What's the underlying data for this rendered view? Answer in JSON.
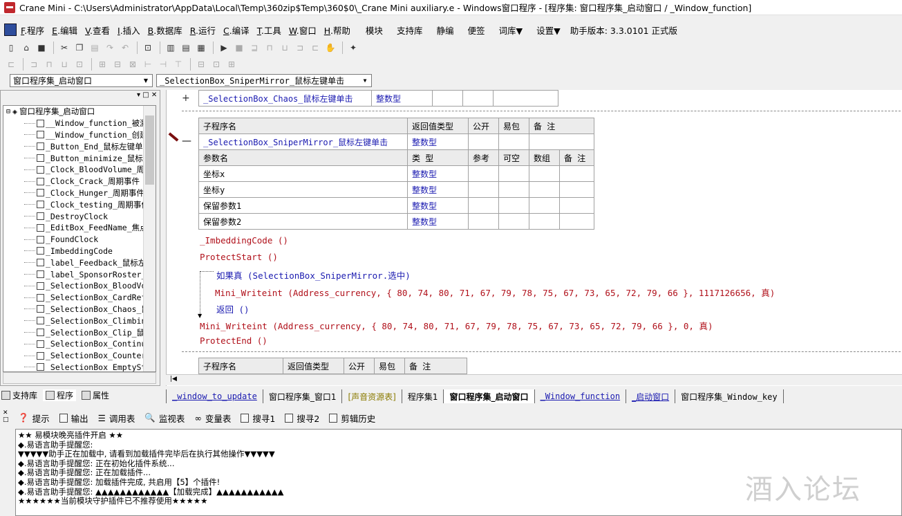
{
  "title": "Crane Mini - C:\\Users\\Administrator\\AppData\\Local\\Temp\\360zip$Temp\\360$0\\_Crane Mini auxiliary.e - Windows窗口程序 - [程序集: 窗口程序集_启动窗口 / _Window_function]",
  "menu": [
    {
      "key": "F",
      "label": ".程序"
    },
    {
      "key": "E",
      "label": ".编辑"
    },
    {
      "key": "V",
      "label": ".查看"
    },
    {
      "key": "I",
      "label": ".插入"
    },
    {
      "key": "B",
      "label": ".数据库"
    },
    {
      "key": "R",
      "label": ".运行"
    },
    {
      "key": "C",
      "label": ".编译"
    },
    {
      "key": "T",
      "label": ".工具"
    },
    {
      "key": "W",
      "label": ".窗口"
    },
    {
      "key": "H",
      "label": ".帮助"
    }
  ],
  "menu_extra": [
    "模块",
    "支持库",
    "静编",
    "便签",
    "词库▼",
    "设置▼",
    "助手版本: 3.3.0101 正式版"
  ],
  "combo1": "窗口程序集_启动窗口",
  "combo2": "_SelectionBox_SniperMirror_鼠标左键单击",
  "tree": {
    "root": "窗口程序集_启动窗口",
    "items": [
      "__Window_function_被激",
      "__Window_function_创建",
      "_Button_End_鼠标左键单",
      "_Button_minimize_鼠标左",
      "_Clock_BloodVolume_周期",
      "_Clock_Crack_周期事件",
      "_Clock_Hunger_周期事件",
      "_Clock_testing_周期事件",
      "_DestroyClock",
      "_EditBox_FeedName_焦点",
      "_FoundClock",
      "_ImbeddingCode",
      "_label_Feedback_鼠标左",
      "_label_SponsorRoster_鼠",
      "_SelectionBox_BloodVol",
      "_SelectionBox_CardRefu",
      "_SelectionBox_Chaos_鼠",
      "_SelectionBox_Climbing",
      "_SelectionBox_Clip_鼠标",
      "_SelectionBox_Continuc",
      "_SelectionBox_CounterI",
      "_SelectionBox_EmptySte"
    ]
  },
  "left_tabs": [
    "支持库",
    "程序",
    "属性"
  ],
  "editor": {
    "top_row": {
      "sign": "+",
      "name": "_SelectionBox_Chaos_鼠标左键单击",
      "type": "整数型"
    },
    "sub_hdr": [
      "子程序名",
      "返回值类型",
      "公开",
      "易包",
      "备 注"
    ],
    "sub_row": {
      "sign": "—",
      "name": "_SelectionBox_SniperMirror_鼠标左键单击",
      "type": "整数型"
    },
    "param_hdr": [
      "参数名",
      "类 型",
      "参考",
      "可空",
      "数组",
      "备 注"
    ],
    "params": [
      {
        "name": "坐标x",
        "type": "整数型"
      },
      {
        "name": "坐标y",
        "type": "整数型"
      },
      {
        "name": "保留参数1",
        "type": "整数型"
      },
      {
        "name": "保留参数2",
        "type": "整数型"
      }
    ],
    "code": [
      "_ImbeddingCode ()",
      "ProtectStart ()",
      "如果真 (SelectionBox_SniperMirror.选中)",
      "Mini_Writeint (Address_currency, { 80, 74, 80, 71, 67, 79, 78, 75, 67, 73, 65, 72, 79, 66 }, 1117126656, 真)",
      "返回 ()",
      "Mini_Writeint (Address_currency, { 80, 74, 80, 71, 67, 79, 78, 75, 67, 73, 65, 72, 79, 66 }, 0, 真)",
      "ProtectEnd ()"
    ],
    "bottom_hdr": [
      "子程序名",
      "返回值类型",
      "公开",
      "易包",
      "备 注"
    ]
  },
  "bottom_tabs": [
    "_window_to_update",
    "窗口程序集_窗口1",
    "[声音资源表]",
    "程序集1",
    "窗口程序集_启动窗口",
    "_Window_function",
    "_启动窗口",
    "窗口程序集_Window_key"
  ],
  "out_tools": [
    "提示",
    "输出",
    "调用表",
    "监视表",
    "变量表",
    "搜寻1",
    "搜寻2",
    "剪辑历史"
  ],
  "output_lines": [
    "★★ 易模块晚亮插件开启 ★★",
    "◆.易语言助手提醒您:",
    "▼▼▼▼▼助手正在加载中, 请看到加载插件完毕后在执行其他操作▼▼▼▼▼",
    "◆.易语言助手提醒您: 正在初始化插件系统...",
    "◆.易语言助手提醒您: 正在加载插件...",
    "◆.易语言助手提醒您: 加载插件完成, 共启用【5】个插件!",
    "◆.易语言助手提醒您: ▲▲▲▲▲▲▲▲▲▲▲▲【加载完成】▲▲▲▲▲▲▲▲▲▲▲",
    "★★★★★★当前模块守护插件已不推荐使用★★★★★"
  ],
  "watermark": "酒入论坛"
}
